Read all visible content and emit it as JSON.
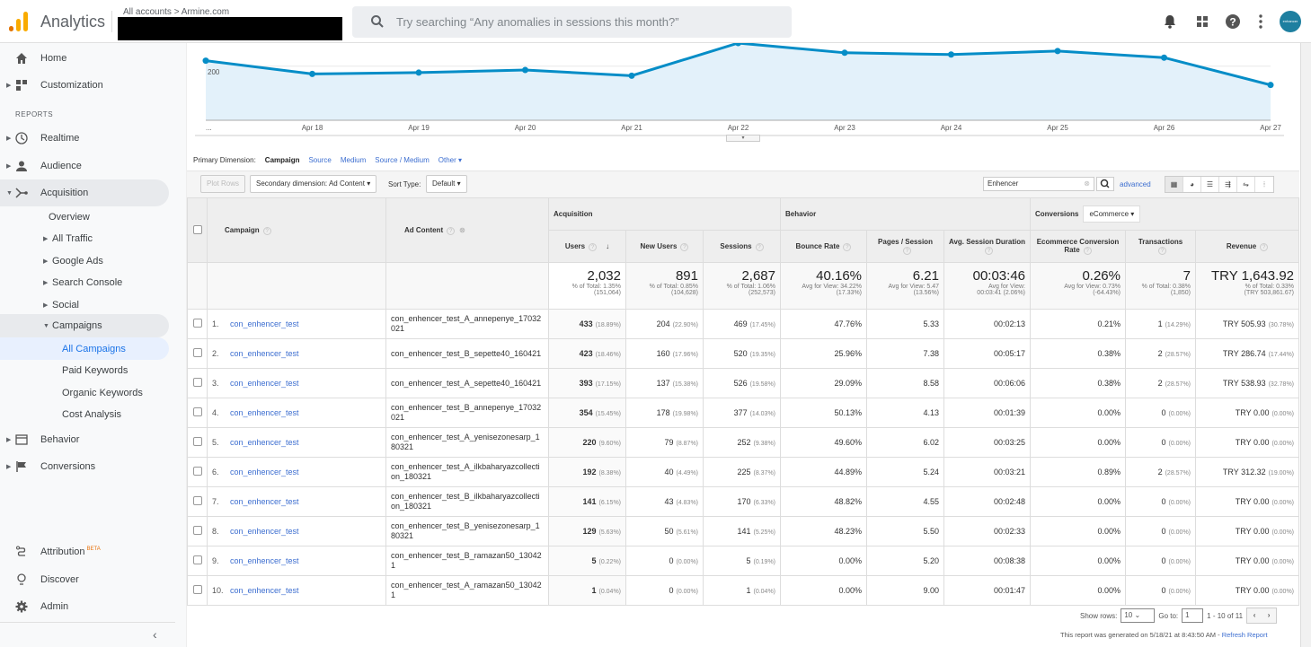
{
  "header": {
    "app_title": "Analytics",
    "breadcrumb": "All accounts > Armine.com",
    "search_placeholder": "Try searching “Any anomalies in sessions this month?”",
    "avatar_text": "enhancer"
  },
  "sidebar": {
    "items": [
      {
        "label": "Home"
      },
      {
        "label": "Customization"
      }
    ],
    "reports_label": "REPORTS",
    "reports": [
      {
        "label": "Realtime"
      },
      {
        "label": "Audience"
      },
      {
        "label": "Acquisition"
      }
    ],
    "acq_sub": [
      {
        "label": "Overview"
      },
      {
        "label": "All Traffic"
      },
      {
        "label": "Google Ads"
      },
      {
        "label": "Search Console"
      },
      {
        "label": "Social"
      },
      {
        "label": "Campaigns"
      }
    ],
    "camp_sub": [
      {
        "label": "All Campaigns"
      },
      {
        "label": "Paid Keywords"
      },
      {
        "label": "Organic Keywords"
      },
      {
        "label": "Cost Analysis"
      }
    ],
    "more": [
      {
        "label": "Behavior"
      },
      {
        "label": "Conversions"
      }
    ],
    "bottom": [
      {
        "label": "Attribution",
        "badge": "BETA"
      },
      {
        "label": "Discover"
      },
      {
        "label": "Admin"
      }
    ]
  },
  "chart_data": {
    "type": "area",
    "series": [
      {
        "name": "Users",
        "values": [
          235,
          205,
          208,
          214,
          201,
          275,
          253,
          249,
          257,
          242,
          180
        ]
      }
    ],
    "x": [
      "...",
      "Apr 18",
      "Apr 19",
      "Apr 20",
      "Apr 21",
      "Apr 22",
      "Apr 23",
      "Apr 24",
      "Apr 25",
      "Apr 26",
      "Apr 27"
    ],
    "y_tick_label": "200",
    "ylim": [
      100,
      275
    ]
  },
  "dimension": {
    "label": "Primary Dimension:",
    "active": "Campaign",
    "options": [
      "Source",
      "Medium",
      "Source / Medium",
      "Other"
    ]
  },
  "toolbar": {
    "plot_rows": "Plot Rows",
    "secondary": "Secondary dimension: Ad Content",
    "sort_label": "Sort Type:",
    "sort_value": "Default",
    "filter_value": "Enhencer",
    "advanced": "advanced"
  },
  "table": {
    "groups": {
      "acquisition": "Acquisition",
      "behavior": "Behavior",
      "conversions": "Conversions",
      "conv_select": "eCommerce"
    },
    "headers": {
      "campaign": "Campaign",
      "ad_content": "Ad Content",
      "users": "Users",
      "new_users": "New Users",
      "sessions": "Sessions",
      "bounce": "Bounce Rate",
      "pages": "Pages / Session",
      "duration": "Avg. Session Duration",
      "conv_rate": "Ecommerce Conversion Rate",
      "transactions": "Transactions",
      "revenue": "Revenue"
    },
    "totals": [
      {
        "big": "2,032",
        "s1": "% of Total: 1.35%",
        "s2": "(151,064)"
      },
      {
        "big": "891",
        "s1": "% of Total: 0.85%",
        "s2": "(104,628)"
      },
      {
        "big": "2,687",
        "s1": "% of Total: 1.06%",
        "s2": "(252,573)"
      },
      {
        "big": "40.16%",
        "s1": "Avg for View: 34.22%",
        "s2": "(17.33%)"
      },
      {
        "big": "6.21",
        "s1": "Avg for View: 5.47",
        "s2": "(13.56%)"
      },
      {
        "big": "00:03:46",
        "s1": "Avg for View:",
        "s2": "00:03:41 (2.06%)"
      },
      {
        "big": "0.26%",
        "s1": "Avg for View: 0.73%",
        "s2": "(-64.43%)"
      },
      {
        "big": "7",
        "s1": "% of Total: 0.38%",
        "s2": "(1,850)"
      },
      {
        "big": "TRY 1,643.92",
        "s1": "% of Total: 0.33%",
        "s2": "(TRY 503,861.67)"
      }
    ],
    "rows": [
      {
        "i": "1.",
        "c": "con_enhencer_test",
        "a": "con_enhencer_test_A_annepenye_17032021",
        "u": "433",
        "up": "(18.89%)",
        "n": "204",
        "np": "(22.90%)",
        "s": "469",
        "sp": "(17.45%)",
        "b": "47.76%",
        "p": "5.33",
        "d": "00:02:13",
        "r": "0.21%",
        "t": "1",
        "tp": "(14.29%)",
        "v": "TRY 505.93",
        "vp": "(30.78%)"
      },
      {
        "i": "2.",
        "c": "con_enhencer_test",
        "a": "con_enhencer_test_B_sepette40_160421",
        "u": "423",
        "up": "(18.46%)",
        "n": "160",
        "np": "(17.96%)",
        "s": "520",
        "sp": "(19.35%)",
        "b": "25.96%",
        "p": "7.38",
        "d": "00:05:17",
        "r": "0.38%",
        "t": "2",
        "tp": "(28.57%)",
        "v": "TRY 286.74",
        "vp": "(17.44%)"
      },
      {
        "i": "3.",
        "c": "con_enhencer_test",
        "a": "con_enhencer_test_A_sepette40_160421",
        "u": "393",
        "up": "(17.15%)",
        "n": "137",
        "np": "(15.38%)",
        "s": "526",
        "sp": "(19.58%)",
        "b": "29.09%",
        "p": "8.58",
        "d": "00:06:06",
        "r": "0.38%",
        "t": "2",
        "tp": "(28.57%)",
        "v": "TRY 538.93",
        "vp": "(32.78%)"
      },
      {
        "i": "4.",
        "c": "con_enhencer_test",
        "a": "con_enhencer_test_B_annepenye_17032021",
        "u": "354",
        "up": "(15.45%)",
        "n": "178",
        "np": "(19.98%)",
        "s": "377",
        "sp": "(14.03%)",
        "b": "50.13%",
        "p": "4.13",
        "d": "00:01:39",
        "r": "0.00%",
        "t": "0",
        "tp": "(0.00%)",
        "v": "TRY 0.00",
        "vp": "(0.00%)"
      },
      {
        "i": "5.",
        "c": "con_enhencer_test",
        "a": "con_enhencer_test_A_yenisezonesarp_180321",
        "u": "220",
        "up": "(9.60%)",
        "n": "79",
        "np": "(8.87%)",
        "s": "252",
        "sp": "(9.38%)",
        "b": "49.60%",
        "p": "6.02",
        "d": "00:03:25",
        "r": "0.00%",
        "t": "0",
        "tp": "(0.00%)",
        "v": "TRY 0.00",
        "vp": "(0.00%)"
      },
      {
        "i": "6.",
        "c": "con_enhencer_test",
        "a": "con_enhencer_test_A_ilkbaharyazcollection_180321",
        "u": "192",
        "up": "(8.38%)",
        "n": "40",
        "np": "(4.49%)",
        "s": "225",
        "sp": "(8.37%)",
        "b": "44.89%",
        "p": "5.24",
        "d": "00:03:21",
        "r": "0.89%",
        "t": "2",
        "tp": "(28.57%)",
        "v": "TRY 312.32",
        "vp": "(19.00%)"
      },
      {
        "i": "7.",
        "c": "con_enhencer_test",
        "a": "con_enhencer_test_B_ilkbaharyazcollection_180321",
        "u": "141",
        "up": "(6.15%)",
        "n": "43",
        "np": "(4.83%)",
        "s": "170",
        "sp": "(6.33%)",
        "b": "48.82%",
        "p": "4.55",
        "d": "00:02:48",
        "r": "0.00%",
        "t": "0",
        "tp": "(0.00%)",
        "v": "TRY 0.00",
        "vp": "(0.00%)"
      },
      {
        "i": "8.",
        "c": "con_enhencer_test",
        "a": "con_enhencer_test_B_yenisezonesarp_180321",
        "u": "129",
        "up": "(5.63%)",
        "n": "50",
        "np": "(5.61%)",
        "s": "141",
        "sp": "(5.25%)",
        "b": "48.23%",
        "p": "5.50",
        "d": "00:02:33",
        "r": "0.00%",
        "t": "0",
        "tp": "(0.00%)",
        "v": "TRY 0.00",
        "vp": "(0.00%)"
      },
      {
        "i": "9.",
        "c": "con_enhencer_test",
        "a": "con_enhencer_test_B_ramazan50_130421",
        "u": "5",
        "up": "(0.22%)",
        "n": "0",
        "np": "(0.00%)",
        "s": "5",
        "sp": "(0.19%)",
        "b": "0.00%",
        "p": "5.20",
        "d": "00:08:38",
        "r": "0.00%",
        "t": "0",
        "tp": "(0.00%)",
        "v": "TRY 0.00",
        "vp": "(0.00%)"
      },
      {
        "i": "10.",
        "c": "con_enhencer_test",
        "a": "con_enhencer_test_A_ramazan50_130421",
        "u": "1",
        "up": "(0.04%)",
        "n": "0",
        "np": "(0.00%)",
        "s": "1",
        "sp": "(0.04%)",
        "b": "0.00%",
        "p": "9.00",
        "d": "00:01:47",
        "r": "0.00%",
        "t": "0",
        "tp": "(0.00%)",
        "v": "TRY 0.00",
        "vp": "(0.00%)"
      }
    ]
  },
  "footer": {
    "show_rows": "Show rows:",
    "rows_value": "10",
    "goto": "Go to:",
    "goto_value": "1",
    "range": "1 - 10 of 11",
    "generated": "This report was generated on 5/18/21 at 8:43:50 AM - ",
    "refresh": "Refresh Report"
  }
}
